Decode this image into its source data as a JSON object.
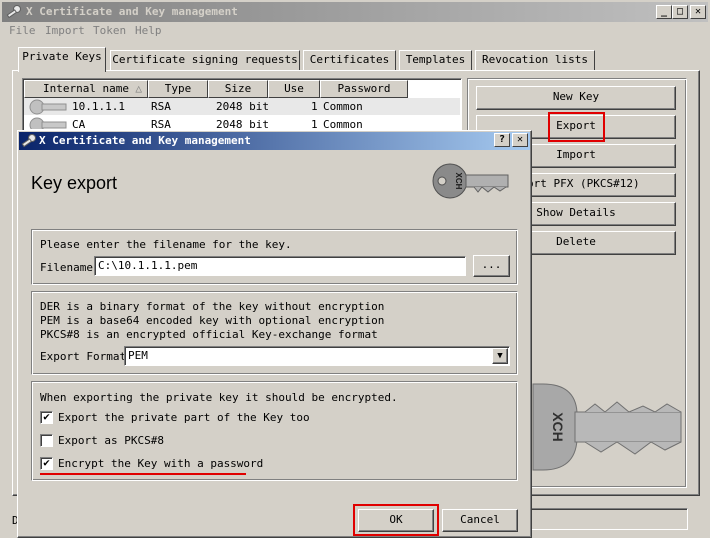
{
  "main_window": {
    "title": "X Certificate and Key management",
    "caption_buttons": [
      "_",
      "□",
      "✕"
    ],
    "menu": [
      "File",
      "Import",
      "Token",
      "Help"
    ],
    "tabs": [
      "Private Keys",
      "Certificate signing requests",
      "Certificates",
      "Templates",
      "Revocation lists"
    ],
    "columns": [
      "Internal name",
      "Type",
      "Size",
      "Use",
      "Password"
    ],
    "rows": [
      {
        "name": "10.1.1.1",
        "type": "RSA",
        "size": "2048 bit",
        "use": "1",
        "password": "Common"
      },
      {
        "name": "CA",
        "type": "RSA",
        "size": "2048 bit",
        "use": "1",
        "password": "Common"
      }
    ],
    "buttons": {
      "new_key": "New Key",
      "export": "Export",
      "import": "Import",
      "import_pfx": "ort PFX (PKCS#12)",
      "show_details": "Show Details",
      "delete": "Delete"
    },
    "key_watermark": "XCH",
    "statusbar_text": "D"
  },
  "dialog": {
    "title": "X Certificate and Key management",
    "caption_buttons": [
      "?",
      "✕"
    ],
    "heading": "Key export",
    "key_graphic_text": "XCH",
    "filename_group": {
      "instruction": "Please enter the filename for the key.",
      "label": "Filename",
      "value": "C:\\10.1.1.1.pem",
      "browse": "..."
    },
    "format_group": {
      "info_lines": [
        "DER is a binary format of the key without encryption",
        "PEM is a base64 encoded key with optional encryption",
        "PKCS#8 is an encrypted official Key-exchange format"
      ],
      "label": "Export Format",
      "selected": "PEM"
    },
    "options_group": {
      "intro": "When exporting the private key it should be encrypted.",
      "options": [
        {
          "label": "Export the private part of the Key too",
          "checked": "✔"
        },
        {
          "label": "Export as PKCS#8",
          "checked": ""
        },
        {
          "label": "Encrypt the Key with a password",
          "checked": "✔"
        }
      ]
    },
    "ok": "OK",
    "cancel": "Cancel"
  },
  "colors": {
    "highlight_red": "#e00000",
    "active_title": "#0a246a",
    "inactive_title": "#808080"
  }
}
